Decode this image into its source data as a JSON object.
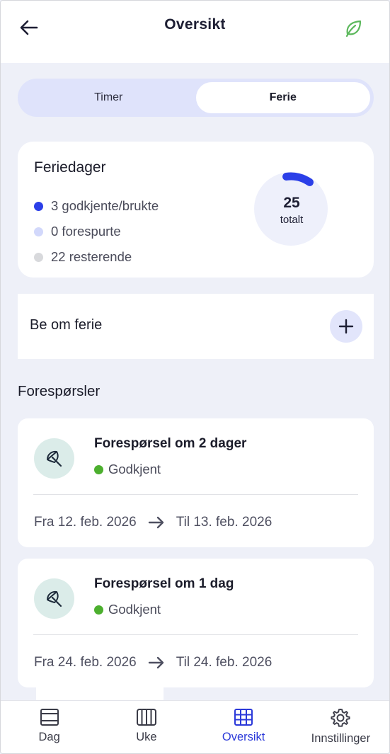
{
  "header": {
    "title": "Oversikt"
  },
  "tabs": [
    {
      "label": "Timer",
      "active": false
    },
    {
      "label": "Ferie",
      "active": true
    }
  ],
  "summary": {
    "title": "Feriedager",
    "legend": [
      {
        "label": "3 godkjente/brukte",
        "color": "#2b3fe8"
      },
      {
        "label": "0 forespurte",
        "color": "#d2d8fb"
      },
      {
        "label": "22 resterende",
        "color": "#d8d9dc"
      }
    ],
    "total_number": "25",
    "total_label": "totalt",
    "used_fraction": 0.12
  },
  "request_action": {
    "label": "Be om ferie"
  },
  "requests_heading": "Forespørsler",
  "requests": [
    {
      "title": "Forespørsel om 2 dager",
      "status": "Godkjent",
      "from": "Fra 12. feb. 2026",
      "to": "Til 13. feb. 2026"
    },
    {
      "title": "Forespørsel om 1 dag",
      "status": "Godkjent",
      "from": "Fra 24. feb. 2026",
      "to": "Til 24. feb. 2026"
    }
  ],
  "nav": [
    {
      "label": "Dag",
      "icon": "day-icon",
      "active": false
    },
    {
      "label": "Uke",
      "icon": "week-icon",
      "active": false
    },
    {
      "label": "Oversikt",
      "icon": "grid-icon",
      "active": true
    },
    {
      "label": "Innstillinger",
      "icon": "gear-icon",
      "active": false
    }
  ],
  "colors": {
    "accent": "#2b39d9",
    "approved": "#4caf2e",
    "leaf": "#5cb85c"
  }
}
